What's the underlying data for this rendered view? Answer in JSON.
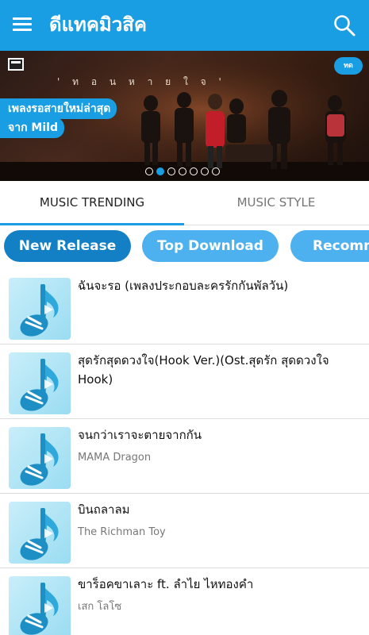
{
  "app": {
    "title": "ดีแทคมิวสิค",
    "accent_color": "#1a9ee3",
    "menu_icon": "hamburger-menu-icon",
    "search_icon": "search-icon"
  },
  "banner": {
    "song_title": "' ท อ น ห า ย ใ จ '",
    "tag_line_1": "เพลงรอสายใหม่ล่าสุด",
    "tag_line_2": "จาก Mild",
    "corner_badge": "ทด",
    "carousel_total": 7,
    "carousel_active": 2
  },
  "tabs": [
    {
      "label": "MUSIC TRENDING",
      "selected": true
    },
    {
      "label": "MUSIC STYLE",
      "selected": false
    }
  ],
  "chips": [
    {
      "label": "New Release",
      "selected": true
    },
    {
      "label": "Top Download",
      "selected": false
    },
    {
      "label": "Recomm",
      "selected": false
    }
  ],
  "songs": [
    {
      "title": "ฉันจะรอ (เพลงประกอบละครรักกันพัลวัน)",
      "artist": ""
    },
    {
      "title": "สุดรักสุดดวงใจ(Hook Ver.)(Ost.สุดรัก สุดดวงใจ Hook)",
      "artist": ""
    },
    {
      "title": "จนกว่าเราจะตายจากกัน",
      "artist": "MAMA Dragon"
    },
    {
      "title": "บินถลาลม",
      "artist": "The Richman Toy"
    },
    {
      "title": "ขาร็อคขาเลาะ ft. ลำไย ไหทองคำ",
      "artist": "เสก โลโซ"
    }
  ]
}
